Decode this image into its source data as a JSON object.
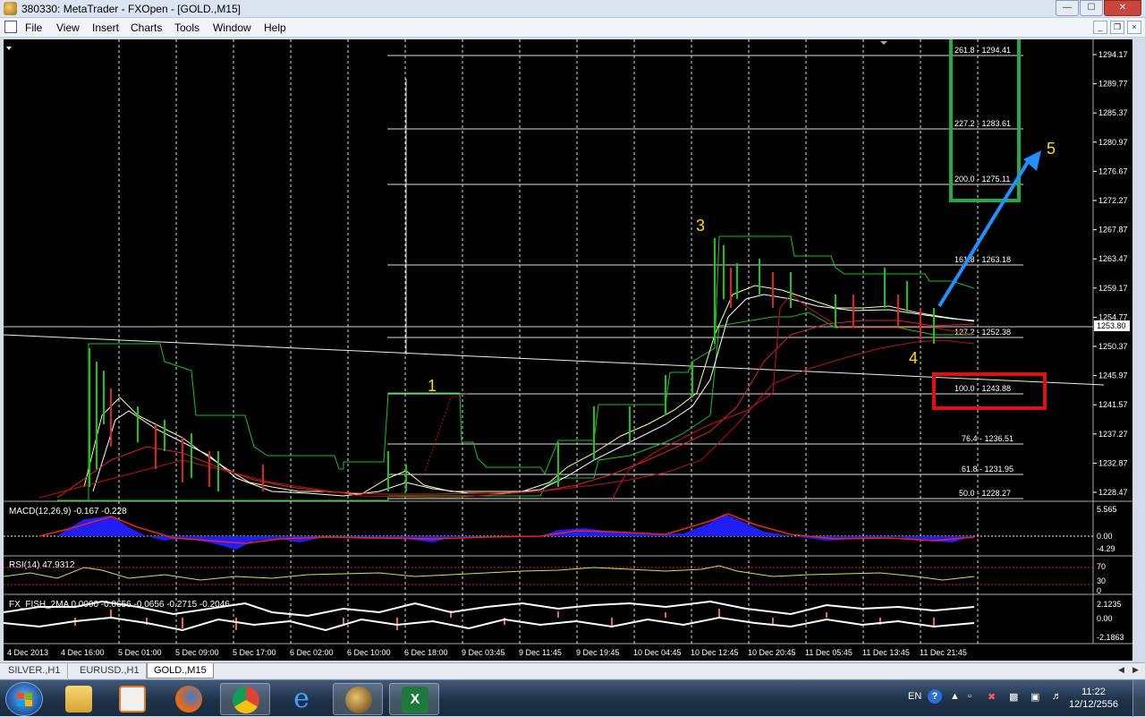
{
  "window": {
    "title": "380330: MetaTrader - FXOpen - [GOLD.,M15]",
    "buttons": {
      "minimize": "—",
      "maximize": "☐",
      "close": "✕"
    }
  },
  "menu": {
    "items": [
      "File",
      "View",
      "Insert",
      "Charts",
      "Tools",
      "Window",
      "Help"
    ],
    "mdi": {
      "minimize": "_",
      "restore": "❐",
      "close": "×"
    }
  },
  "chart": {
    "symbol": "GOLD.,M15",
    "price_axis": [
      "1294.17",
      "1289.77",
      "1285.37",
      "1280.97",
      "1276.67",
      "1272.27",
      "1267.87",
      "1263.47",
      "1259.17",
      "1254.77",
      "1250.37",
      "1245.97",
      "1241.57",
      "1237.27",
      "1232.87",
      "1228.47"
    ],
    "current_price": "1253.80",
    "fibo_levels": [
      {
        "label": "261.8 - 1294.41",
        "ratio": 261.8,
        "price": 1294.41
      },
      {
        "label": "227.2 - 1283.61",
        "ratio": 227.2,
        "price": 1283.61
      },
      {
        "label": "200.0 - 1275.11",
        "ratio": 200.0,
        "price": 1275.11
      },
      {
        "label": "161.8 - 1263.18",
        "ratio": 161.8,
        "price": 1263.18
      },
      {
        "label": "127.2 - 1252.38",
        "ratio": 127.2,
        "price": 1252.38
      },
      {
        "label": "100.0 - 1243.88",
        "ratio": 100.0,
        "price": 1243.88
      },
      {
        "label": "76.4 - 1236.51",
        "ratio": 76.4,
        "price": 1236.51
      },
      {
        "label": "61.8 - 1231.95",
        "ratio": 61.8,
        "price": 1231.95
      },
      {
        "label": "50.0 - 1228.27",
        "ratio": 50.0,
        "price": 1228.27
      }
    ],
    "wave_labels": [
      "1",
      "3",
      "4",
      "5"
    ],
    "time_axis": [
      "4 Dec 2013",
      "4 Dec 16:00",
      "5 Dec 01:00",
      "5 Dec 09:00",
      "5 Dec 17:00",
      "6 Dec 02:00",
      "6 Dec 10:00",
      "6 Dec 18:00",
      "9 Dec 03:45",
      "9 Dec 11:45",
      "9 Dec 19:45",
      "10 Dec 04:45",
      "10 Dec 12:45",
      "10 Dec 20:45",
      "11 Dec 05:45",
      "11 Dec 13:45",
      "11 Dec 21:45"
    ],
    "colors": {
      "fib_target_box": "#22aa44",
      "support_box": "#dd1111",
      "arrow": "#1e90ff",
      "wave_label": "#ffdd00",
      "price_channel": "#19c419",
      "macd_histogram": "#1f1ff5"
    }
  },
  "macd": {
    "label": "MACD(12,26,9) -0.167 -0.228",
    "axis": [
      "5.565",
      "0.00",
      "-4.29"
    ]
  },
  "rsi": {
    "label": "RSI(14) 47.9312",
    "axis": [
      "70",
      "30",
      "0"
    ]
  },
  "fisher": {
    "label": "FX_FISH_2MA 0.0000 -0.0656 -0.0656 -0.2715 -0.2046",
    "axis": [
      "2.1235",
      "0.00",
      "-2.1863"
    ]
  },
  "tabs": [
    "SILVER.,H1",
    "EURUSD.,H1",
    "GOLD.,M15"
  ],
  "active_tab": "GOLD.,M15",
  "taskbar": {
    "apps": [
      "explorer",
      "media-player",
      "firefox",
      "chrome",
      "internet-explorer",
      "metatrader",
      "excel"
    ],
    "language": "EN",
    "time": "11:22",
    "date": "12/12/2556"
  }
}
